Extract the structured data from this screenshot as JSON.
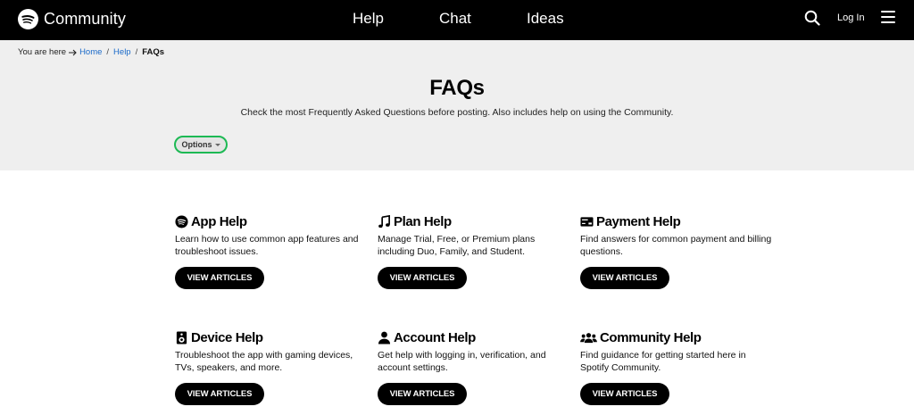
{
  "header": {
    "brand": "Community",
    "nav": [
      "Help",
      "Chat",
      "Ideas"
    ],
    "login": "Log In"
  },
  "breadcrumb": {
    "prefix": "You are here",
    "items": [
      "Home",
      "Help",
      "FAQs"
    ]
  },
  "hero": {
    "title": "FAQs",
    "subtitle": "Check the most Frequently Asked Questions before posting. Also includes help on using the Community.",
    "options_label": "Options"
  },
  "cards": [
    {
      "icon": "spotify-icon",
      "title": "App Help",
      "desc": "Learn how to use common app features and troubleshoot issues.",
      "button": "VIEW ARTICLES"
    },
    {
      "icon": "music-note-icon",
      "title": "Plan Help",
      "desc": "Manage Trial, Free, or Premium plans including Duo, Family, and Student.",
      "button": "VIEW ARTICLES"
    },
    {
      "icon": "payment-card-icon",
      "title": "Payment Help",
      "desc": "Find answers for common payment and billing questions.",
      "button": "VIEW ARTICLES"
    },
    {
      "icon": "speaker-icon",
      "title": "Device Help",
      "desc": "Troubleshoot the app with gaming devices, TVs, speakers, and more.",
      "button": "VIEW ARTICLES"
    },
    {
      "icon": "user-icon",
      "title": "Account Help",
      "desc": "Get help with logging in, verification, and account settings.",
      "button": "VIEW ARTICLES"
    },
    {
      "icon": "group-icon",
      "title": "Community Help",
      "desc": "Find guidance for getting started here in Spotify Community.",
      "button": "VIEW ARTICLES"
    }
  ],
  "colors": {
    "accent": "#1db954",
    "link": "#1b6ac9",
    "topbar": "#000000",
    "hero_bg": "#efefef"
  }
}
